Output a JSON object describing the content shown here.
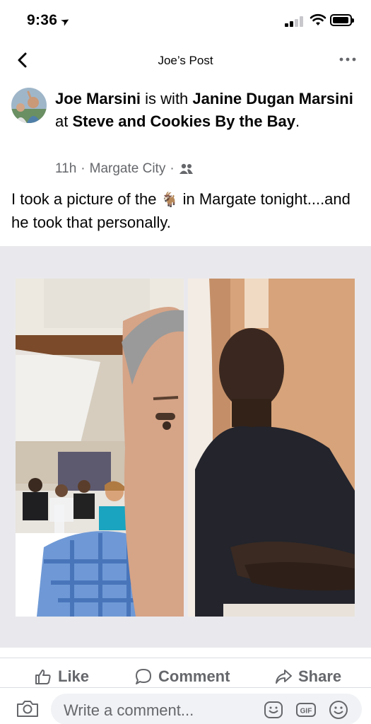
{
  "status_bar": {
    "time": "9:36"
  },
  "nav": {
    "title": "Joe’s Post"
  },
  "post": {
    "author": "Joe Marsini",
    "with_text": "is with",
    "tagged": "Janine Dugan Marsini",
    "at_text": "at",
    "place": "Steve and Cookies By the Bay",
    "period": ".",
    "time_ago": "11h",
    "location": "Margate City",
    "separator": "·",
    "text_before_emoji": "I took a picture of the",
    "emoji": "🐐",
    "text_after_emoji": "in Margate tonight....and he took that personally."
  },
  "actions": {
    "like_label": "Like",
    "comment_label": "Comment",
    "share_label": "Share"
  },
  "composer": {
    "placeholder": "Write a comment...",
    "gif_label": "GIF"
  },
  "colors": {
    "text": "#050505",
    "secondary": "#65676b",
    "divider": "#dadde1",
    "photo_bg": "#e9e9ed",
    "input_bg": "#f0f2f5"
  }
}
